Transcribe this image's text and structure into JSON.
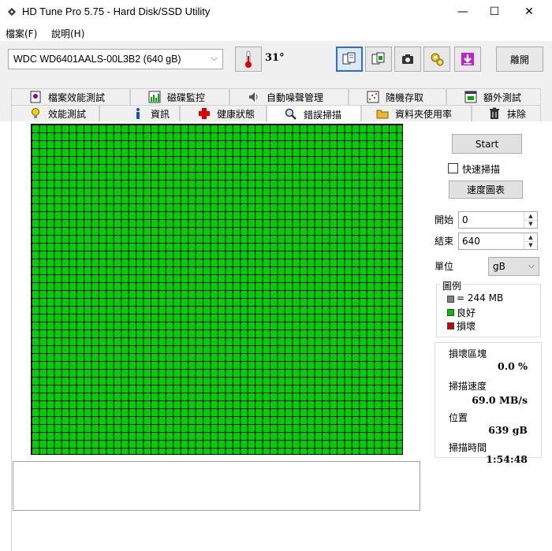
{
  "window": {
    "title": "HD Tune Pro 5.75 - Hard Disk/SSD Utility",
    "minimize": "—",
    "maximize": "☐",
    "close": "✕"
  },
  "menu": {
    "file": "檔案(F)",
    "help": "說明(H)"
  },
  "toolbar": {
    "drive": "WDC WD6401AALS-00L3B2 (640 gB)",
    "temperature": "31°",
    "exit": "離開"
  },
  "tabs": {
    "row1": [
      "檔案效能測試",
      "磁碟監控",
      "自動噪聲管理",
      "隨機存取",
      "額外測試"
    ],
    "row2": [
      "效能測試",
      "資訊",
      "健康狀態",
      "錯誤掃描",
      "資料夾使用率",
      "抹除"
    ],
    "active": "錯誤掃描"
  },
  "scan": {
    "start_label": "Start",
    "quick_scan_label": "快速掃描",
    "quick_scan_checked": false,
    "speed_map_label": "速度圖表",
    "start_field_label": "開始",
    "start_value": "0",
    "end_field_label": "結束",
    "end_value": "640",
    "unit_label": "單位",
    "unit_value": "gB"
  },
  "legend": {
    "title": "圖例",
    "block": "= 244 MB",
    "good": "良好",
    "bad": "損壞",
    "colors": {
      "block": "#808080",
      "good": "#00c000",
      "bad": "#d00000",
      "grid_fill": "#00d000"
    }
  },
  "stats": {
    "damaged_label": "損壞區塊",
    "damaged_value": "0.0 %",
    "speed_label": "掃描速度",
    "speed_value": "69.0 MB/s",
    "position_label": "位置",
    "position_value": "639 gB",
    "time_label": "掃描時間",
    "time_value": "1:54:48"
  }
}
